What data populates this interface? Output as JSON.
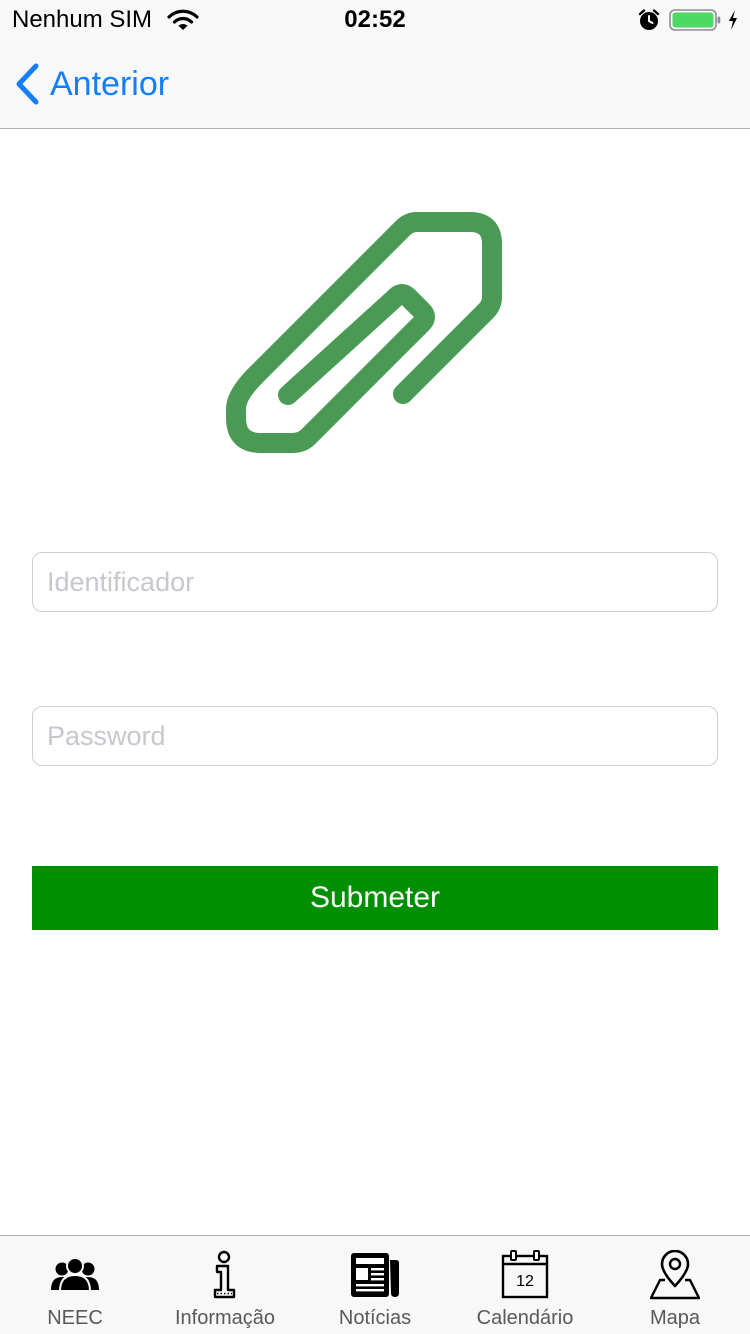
{
  "status_bar": {
    "carrier": "Nenhum SIM",
    "time": "02:52",
    "battery_level": 1.0,
    "battery_color": "#4cd964",
    "icons": [
      "wifi-icon",
      "alarm-icon",
      "battery-icon",
      "charging-icon"
    ]
  },
  "nav": {
    "back_label": "Anterior",
    "back_icon": "chevron-left-icon",
    "accent_color": "#147efb"
  },
  "logo": {
    "icon": "paperclip-icon",
    "color": "#4a9a55"
  },
  "form": {
    "identificador_placeholder": "Identificador",
    "identificador_value": "",
    "password_placeholder": "Password",
    "password_value": "",
    "submit_label": "Submeter",
    "submit_color": "#008f00"
  },
  "tabs": [
    {
      "label": "NEEC",
      "icon": "people-icon"
    },
    {
      "label": "Informação",
      "icon": "info-icon"
    },
    {
      "label": "Notícias",
      "icon": "newspaper-icon"
    },
    {
      "label": "Calendário",
      "icon": "calendar-icon",
      "calendar_day": "12"
    },
    {
      "label": "Mapa",
      "icon": "map-pin-icon"
    }
  ]
}
